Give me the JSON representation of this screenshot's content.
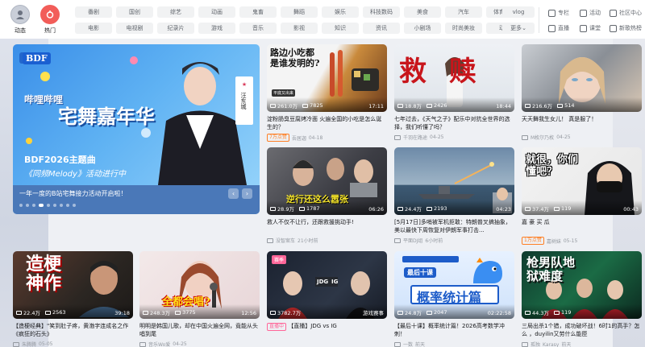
{
  "nav": {
    "dongtai": "动态",
    "remen": "热门",
    "chips_row1": [
      "番剧",
      "国创",
      "综艺",
      "动画",
      "鬼畜",
      "舞蹈",
      "娱乐",
      "科技数码",
      "美食",
      "汽车",
      "体育运动",
      "vlog"
    ],
    "chips_row2": [
      "电影",
      "电视剧",
      "纪录片",
      "游戏",
      "音乐",
      "影视",
      "知识",
      "资讯",
      "小剧场",
      "时尚美妆",
      "动物",
      "更多"
    ],
    "side_links": [
      "专栏",
      "活动",
      "社区中心",
      "直播",
      "课堂",
      "新歌热榜"
    ]
  },
  "banner": {
    "logo": "BDF",
    "title_line1": "哔哩哔哩",
    "title_line2": "宅舞嘉年华",
    "subtitle": "BDF2026主题曲",
    "subtitle2": "《同频Melody》活动进行中",
    "person_name": "汪东城",
    "caption": "一年一度的B站宅舞接力活动开启啦！"
  },
  "cards": [
    {
      "thumb_text": "路边小吃都是谁发明的?",
      "thumb_sub": "平底又出来",
      "views": "261.0万",
      "danmaku": "7825",
      "duration": "17:11",
      "title": "淀粉肠臭豆腐烤冷面 火遍全国的小吃是怎么诞生的？",
      "tag": "7万点赞",
      "uploader": "吾居迦",
      "date": "04-18"
    },
    {
      "thumb_text": "救 赎",
      "views": "18.8万",
      "danmaku": "2426",
      "duration": "18:44",
      "title": "七年过去，《天气之子》配乐中对抗全世界的选择，我们听懂了吗？",
      "tag": "",
      "uploader": "千羽在路途",
      "date": "04-25"
    },
    {
      "views": "216.6万",
      "danmaku": "514",
      "duration": "",
      "title": "天天舞我生女儿！ 真是服了！",
      "tag": "",
      "uploader": "M枚尔乃枚",
      "date": "04-25"
    },
    {
      "thumb_text": "逆行还这么嚣张",
      "views": "28.9万",
      "danmaku": "1787",
      "duration": "06:26",
      "title": "救人不仅不让行，还跟救援挑动手!",
      "tag": "",
      "uploader": "没智案车",
      "date": "21小时前"
    },
    {
      "views": "24.4万",
      "danmaku": "2193",
      "duration": "04:23",
      "title": "[5月17日]多哨被军机拒敢：特朗普叉搞抽象，美以最快下周恢复对伊朗军事打击...",
      "tag": "",
      "uploader": "平面DJ组",
      "date": "6小时前"
    },
    {
      "thumb_text": "就很，你们懂吧？",
      "views": "37.4万",
      "danmaku": "119",
      "duration": "00:43",
      "title": "嘉 豪 买 瓜",
      "tag": "1万点赞",
      "uploader": "嘉树妹",
      "date": "05-15"
    },
    {
      "thumb_text": "造梗神作",
      "views": "22.4万",
      "danmaku": "2563",
      "duration": "39:18",
      "title": "【造梗经典】\"笑到肚子疼，黄渤字连成名之作《疯狂的石头》",
      "tag": "",
      "uploader": "朱腾腾",
      "date": "05-05"
    },
    {
      "thumb_text": "全都会唱?",
      "views": "248.3万",
      "danmaku": "3775",
      "duration": "12:56",
      "title": "明明是韩国儿歌，却在中国火遍全网，竟能从头唱到尾",
      "tag": "",
      "uploader": "音乐Wo爱",
      "date": "04-25"
    },
    {
      "badge": "赛季",
      "team1": "JDG",
      "team2": "IG",
      "views": "3782.7万",
      "danmaku": "",
      "duration": "游戏赛事",
      "title": "【直播】JDG vs IG",
      "tag": "直播中",
      "uploader": "",
      "date": ""
    },
    {
      "thumb_text": "概率统计篇",
      "thumb_sub": "最后十课",
      "views": "24.8万",
      "danmaku": "2047",
      "duration": "02:22:58",
      "title": "【最后十课】概率统计篇！2026高考数学冲刺！",
      "tag": "",
      "uploader": "一数",
      "date": "前天"
    },
    {
      "thumb_text": "枪男队地狱难度",
      "views": "44.3万",
      "danmaku": "119",
      "duration": "",
      "title": "三局出杀1个猎，成功破坏战！6时1的高手？怎么 ，duyilin又劳什么能匣",
      "tag": "",
      "uploader": "孤独_Karasy",
      "date": "前天"
    }
  ]
}
